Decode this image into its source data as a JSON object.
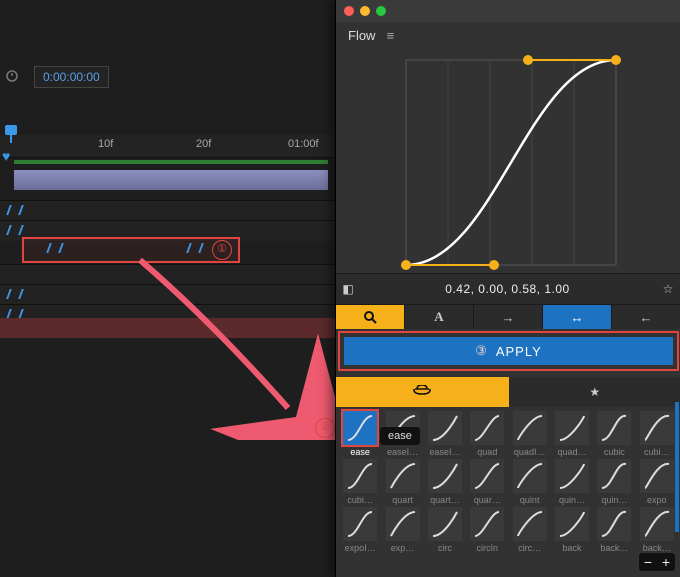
{
  "timeline": {
    "timecode": "0:00:00:00",
    "ticks": [
      "10f",
      "20f",
      "01:00f"
    ],
    "callout1": "①"
  },
  "panel": {
    "title": "Flow",
    "bezier": "0.42, 0.00, 0.58, 1.00",
    "apply": "APPLY",
    "apply_callout_marker": "③",
    "preset_callout": "②",
    "tooltip": "ease"
  },
  "presets_row1": [
    "ease",
    "easeI…",
    "easeI…",
    "quad",
    "quadI…",
    "quad…",
    "cubic",
    "cubi…"
  ],
  "presets_row2": [
    "cubi…",
    "quart",
    "quart…",
    "quar…",
    "quint",
    "quin…",
    "quin…",
    "expo"
  ],
  "presets_row3": [
    "expoI…",
    "exp…",
    "circ",
    "circIn",
    "circ…",
    "back",
    "back…",
    "back…"
  ],
  "chart_data": {
    "type": "line",
    "title": "",
    "xlabel": "",
    "ylabel": "",
    "x": [
      0.0,
      0.42,
      0.58,
      1.0
    ],
    "y": [
      0.0,
      0.0,
      1.0,
      1.0
    ],
    "bezier_control_points": {
      "p1": [
        0.42,
        0.0
      ],
      "p2": [
        0.58,
        1.0
      ]
    },
    "xlim": [
      0,
      1
    ],
    "ylim": [
      0,
      1
    ]
  }
}
